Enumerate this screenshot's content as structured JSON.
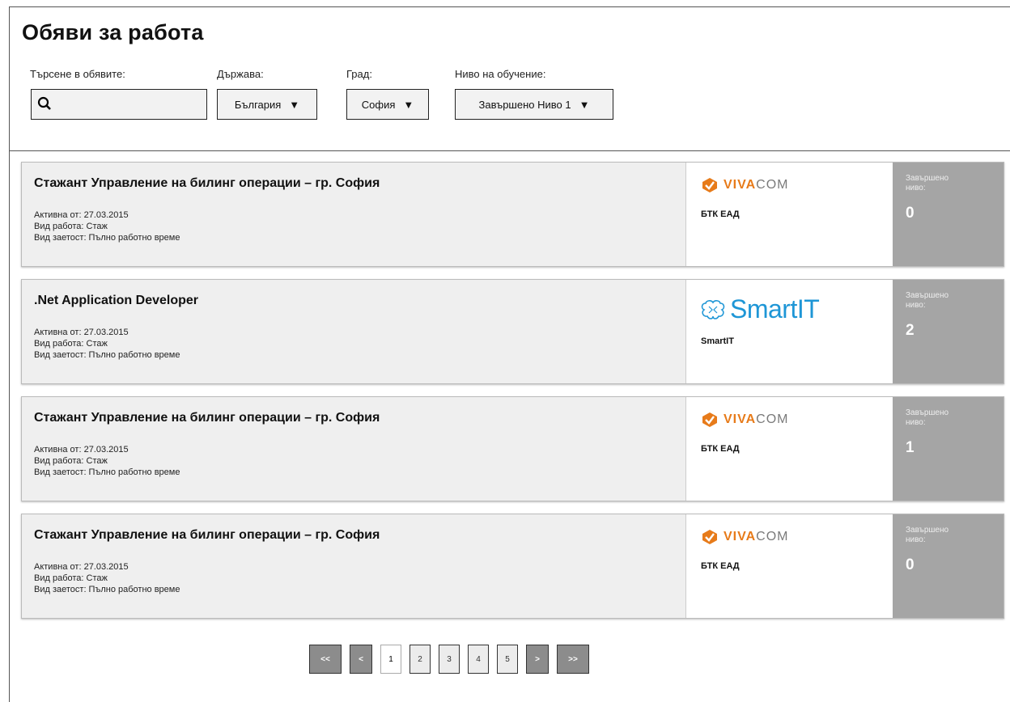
{
  "page_title": "Обяви за работа",
  "filters": {
    "search": {
      "label": "Търсене в обявите:",
      "value": "",
      "placeholder": ""
    },
    "country": {
      "label": "Държава:",
      "selected": "България"
    },
    "city": {
      "label": "Град:",
      "selected": "София"
    },
    "education": {
      "label": "Ниво на обучение:",
      "selected": "Завършено Ниво 1"
    }
  },
  "jobs": [
    {
      "title": "Стажант Управление на билинг операции – гр. София",
      "active_from": "Активна от: 27.03.2015",
      "work_type": "Вид работа: Стаж",
      "employment": "Вид заетост: Пълно работно време",
      "logo": "vivacom-logo",
      "logo_text_a": "VIVA",
      "logo_text_b": "COM",
      "company": "БТК ЕАД",
      "level_label": "Завършено ниво:",
      "level": "0"
    },
    {
      "title": ".Net Application Developer",
      "active_from": "Активна от: 27.03.2015",
      "work_type": "Вид работа: Стаж",
      "employment": "Вид заетост: Пълно работно време",
      "logo": "smartit-logo",
      "logo_text_a": "SmartIT",
      "logo_text_b": "",
      "company": "SmartIT",
      "level_label": "Завършено ниво:",
      "level": "2"
    },
    {
      "title": "Стажант Управление на билинг операции – гр. София",
      "active_from": "Активна от: 27.03.2015",
      "work_type": "Вид работа: Стаж",
      "employment": "Вид заетост: Пълно работно време",
      "logo": "vivacom-logo",
      "logo_text_a": "VIVA",
      "logo_text_b": "COM",
      "company": "БТК ЕАД",
      "level_label": "Завършено ниво:",
      "level": "1"
    },
    {
      "title": "Стажант Управление на билинг операции – гр. София",
      "active_from": "Активна от: 27.03.2015",
      "work_type": "Вид работа: Стаж",
      "employment": "Вид заетост: Пълно работно време",
      "logo": "vivacom-logo",
      "logo_text_a": "VIVA",
      "logo_text_b": "COM",
      "company": "БТК ЕАД",
      "level_label": "Завършено ниво:",
      "level": "0"
    }
  ],
  "pagination": {
    "first": "<<",
    "prev": "<",
    "pages": [
      "1",
      "2",
      "3",
      "4",
      "5"
    ],
    "current": "1",
    "next": ">",
    "last": ">>"
  },
  "colors": {
    "vivacom_orange": "#e77b1a",
    "smartit_blue": "#1e96d6",
    "level_bg": "#a5a5a5",
    "card_bg": "#efefef"
  }
}
